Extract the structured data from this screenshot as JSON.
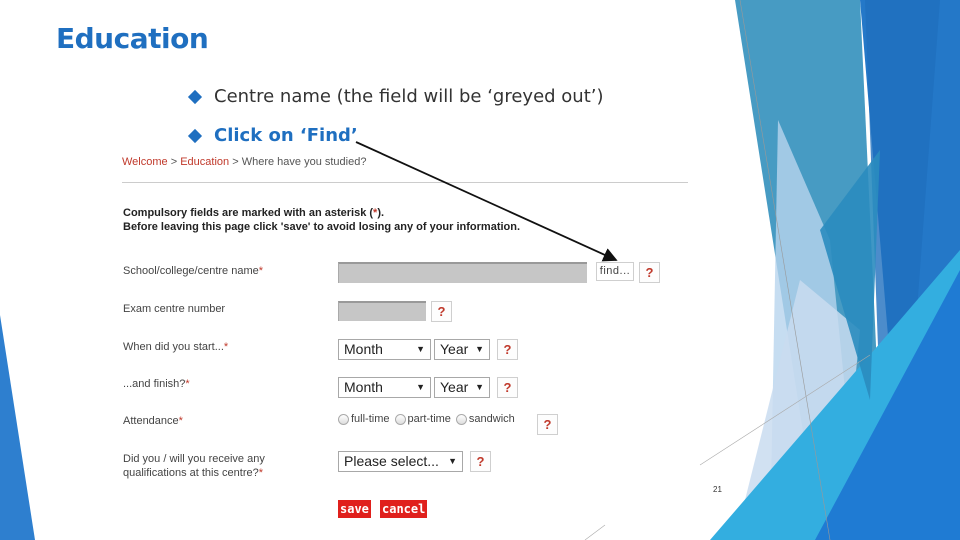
{
  "slide": {
    "title": "Education",
    "bullets": [
      "Centre name (the field will be ‘greyed out’)",
      "Click on ‘Find’"
    ],
    "page_number": "21",
    "accent_color": "#1f6fc0"
  },
  "form": {
    "breadcrumb": {
      "items": [
        "Welcome",
        "Education",
        "Where have you studied?"
      ],
      "separator": ">"
    },
    "notice": {
      "line1_before": "Compulsory fields are marked with an asterisk (",
      "asterisk": "*",
      "line1_after": ").",
      "line2": "Before leaving this page click 'save' to avoid losing any of your information."
    },
    "fields": {
      "centre_name": {
        "label": "School/college/centre name",
        "required": "*",
        "value": "",
        "find_label": "find...",
        "help": "?"
      },
      "exam_centre_number": {
        "label": "Exam centre number",
        "value": "",
        "help": "?"
      },
      "start": {
        "label": "When did you start...",
        "required": "*",
        "month": "Month",
        "year": "Year",
        "help": "?"
      },
      "finish": {
        "label": "...and finish?",
        "required": "*",
        "month": "Month",
        "year": "Year",
        "help": "?"
      },
      "attendance": {
        "label": "Attendance",
        "required": "*",
        "options": [
          "full-time",
          "part-time",
          "sandwich"
        ],
        "help": "?"
      },
      "qualifications": {
        "label_line1": "Did you / will you receive any",
        "label_line2": "qualifications at this centre?",
        "required": "*",
        "value": "Please select...",
        "help": "?"
      }
    },
    "buttons": {
      "save": "save",
      "cancel": "cancel"
    },
    "dropdown_arrow": "▼"
  }
}
